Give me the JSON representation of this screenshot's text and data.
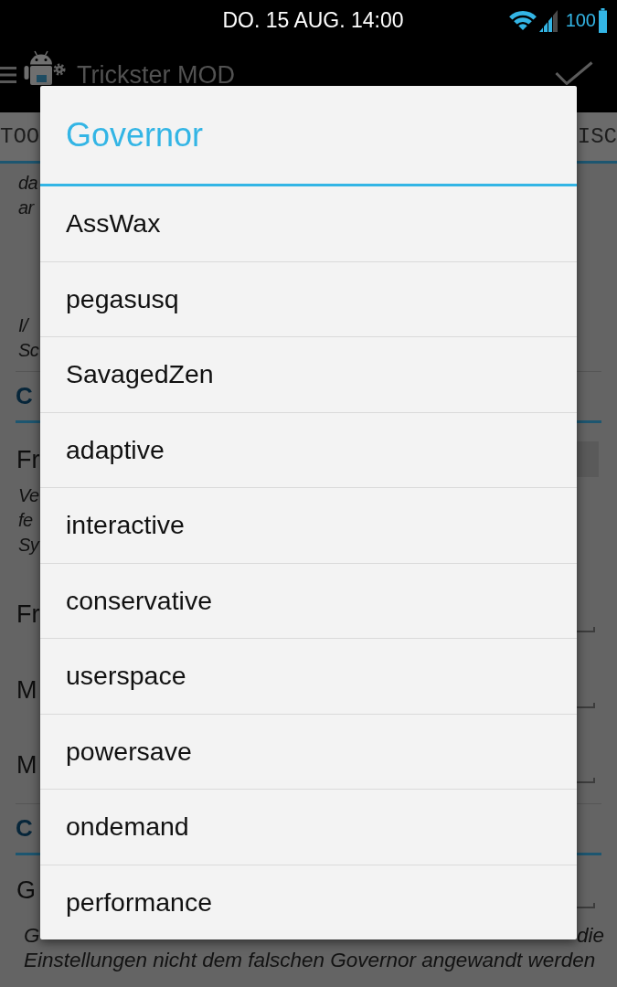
{
  "status_bar": {
    "clock": "DO. 15 AUG. 14:00",
    "battery": "100"
  },
  "app_bar": {
    "title": "Trickster MOD"
  },
  "tabs": [
    {
      "label": "TOO"
    },
    {
      "label": "ISC"
    }
  ],
  "page": [
    {
      "kind": "note",
      "lines": [
        "da",
        "ar"
      ]
    },
    {
      "kind": "note",
      "lines": [
        "I/",
        "Sc"
      ]
    },
    {
      "kind": "heading",
      "text": "C"
    },
    {
      "kind": "setting",
      "label": "Fr",
      "control": {
        "kind": "toggle"
      }
    },
    {
      "kind": "note",
      "lines": [
        "Ve",
        "fe",
        "Sy"
      ]
    },
    {
      "kind": "setting",
      "label": "Fr",
      "control": {
        "kind": "field"
      }
    },
    {
      "kind": "setting",
      "label": "M",
      "control": {
        "kind": "field"
      }
    },
    {
      "kind": "setting",
      "label": "M",
      "control": {
        "kind": "field"
      }
    },
    {
      "kind": "heading",
      "text": "C"
    },
    {
      "kind": "setting",
      "label": "G",
      "control": {
        "kind": "field"
      }
    },
    {
      "kind": "footer",
      "lines": [
        {
          "text": "G",
          "end": "die"
        },
        {
          "text": "Einstellungen nicht dem falschen Governor angewandt werden"
        }
      ]
    }
  ],
  "dialog": {
    "title": "Governor",
    "options": [
      "AssWax",
      "pegasusq",
      "SavagedZen",
      "adaptive",
      "interactive",
      "conservative",
      "userspace",
      "powersave",
      "ondemand",
      "performance"
    ]
  }
}
